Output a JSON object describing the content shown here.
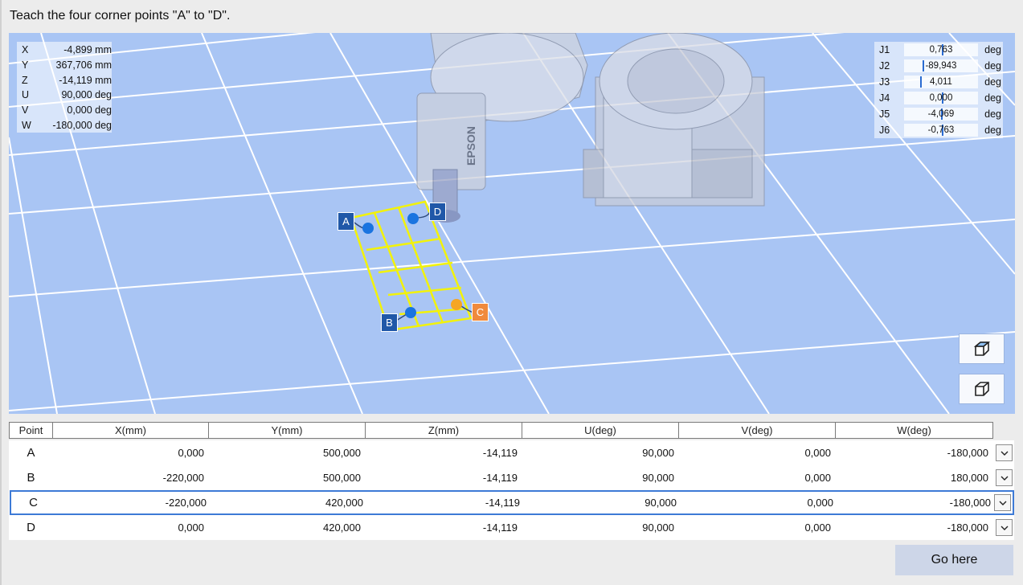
{
  "instruction": "Teach the four corner points \"A\" to \"D\".",
  "cartesian": [
    {
      "axis": "X",
      "value": "-4,899 mm"
    },
    {
      "axis": "Y",
      "value": "367,706 mm"
    },
    {
      "axis": "Z",
      "value": "-14,119 mm"
    },
    {
      "axis": "U",
      "value": "90,000 deg"
    },
    {
      "axis": "V",
      "value": "0,000 deg"
    },
    {
      "axis": "W",
      "value": "-180,000 deg"
    }
  ],
  "joints": [
    {
      "name": "J1",
      "value": "0,763",
      "unit": "deg",
      "level": 0.5
    },
    {
      "name": "J2",
      "value": "-89,943",
      "unit": "deg",
      "level": 0.25
    },
    {
      "name": "J3",
      "value": "4,011",
      "unit": "deg",
      "level": 0.21
    },
    {
      "name": "J4",
      "value": "0,000",
      "unit": "deg",
      "level": 0.5
    },
    {
      "name": "J5",
      "value": "-4,069",
      "unit": "deg",
      "level": 0.49
    },
    {
      "name": "J6",
      "value": "-0,763",
      "unit": "deg",
      "level": 0.5
    }
  ],
  "robot_brand": "EPSON",
  "markers": {
    "A": "A",
    "B": "B",
    "C": "C",
    "D": "D"
  },
  "colors": {
    "marker_blue": "#2058a8",
    "marker_orange": "#f08a3c",
    "point_blue": "#1a74e0",
    "point_orange": "#f5a623",
    "grid_yellow": "#f2f20a"
  },
  "table": {
    "headers": [
      "Point",
      "X(mm)",
      "Y(mm)",
      "Z(mm)",
      "U(deg)",
      "V(deg)",
      "W(deg)"
    ],
    "rows": [
      {
        "point": "A",
        "x": "0,000",
        "y": "500,000",
        "z": "-14,119",
        "u": "90,000",
        "v": "0,000",
        "w": "-180,000"
      },
      {
        "point": "B",
        "x": "-220,000",
        "y": "500,000",
        "z": "-14,119",
        "u": "90,000",
        "v": "0,000",
        "w": "180,000"
      },
      {
        "point": "C",
        "x": "-220,000",
        "y": "420,000",
        "z": "-14,119",
        "u": "90,000",
        "v": "0,000",
        "w": "-180,000"
      },
      {
        "point": "D",
        "x": "0,000",
        "y": "420,000",
        "z": "-14,119",
        "u": "90,000",
        "v": "0,000",
        "w": "-180,000"
      }
    ],
    "selected_row": "C"
  },
  "go_here_label": "Go here",
  "view_buttons": [
    "cube-view-icon",
    "cube-view-alt-icon"
  ]
}
